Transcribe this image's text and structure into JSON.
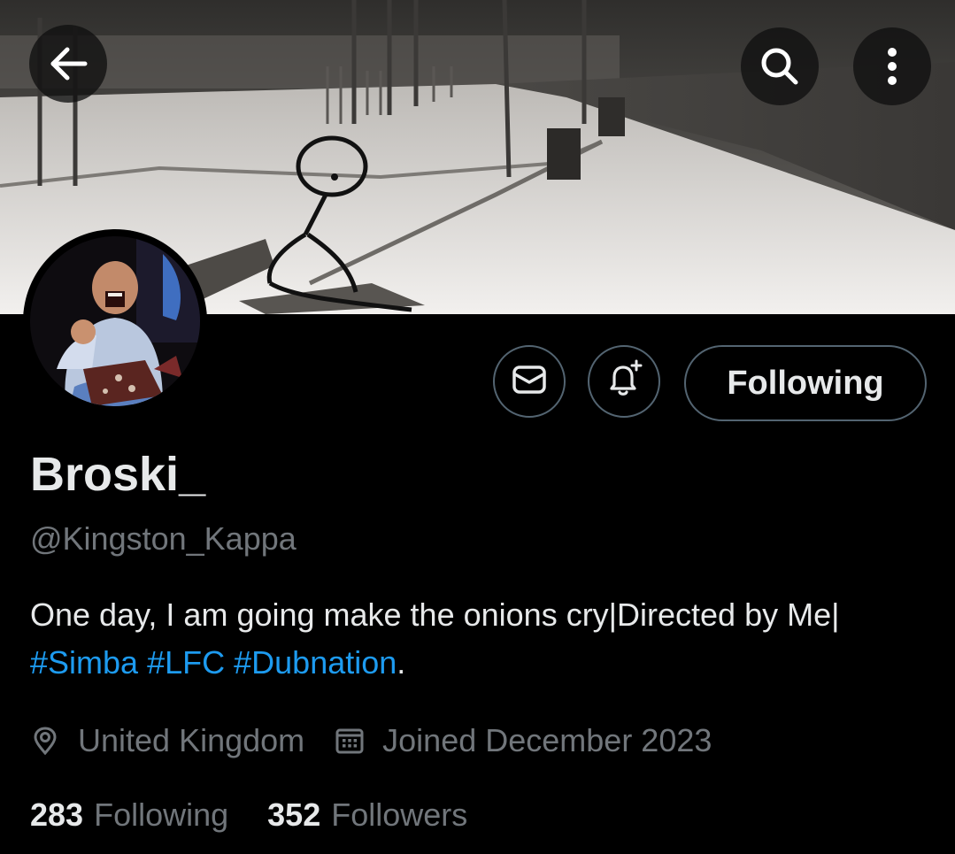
{
  "header": {
    "back_icon": "arrow-left-icon",
    "search_icon": "search-icon",
    "more_icon": "more-vertical-icon"
  },
  "actions": {
    "message_icon": "envelope-icon",
    "notify_icon": "bell-plus-icon",
    "follow_label": "Following"
  },
  "profile": {
    "display_name": "Broski_",
    "handle": "@Kingston_Kappa",
    "bio_text": "One day, I am going make the onions cry|Directed by Me|",
    "bio_hashtags": [
      "#Simba",
      "#LFC",
      "#Dubnation"
    ],
    "bio_suffix": ".",
    "location": "United Kingdom",
    "joined": "Joined December 2023"
  },
  "stats": {
    "following_count": "283",
    "following_label": "Following",
    "followers_count": "352",
    "followers_label": "Followers"
  },
  "colors": {
    "background": "#000000",
    "text_primary": "#e7e9ea",
    "text_secondary": "#71767b",
    "border": "#536471",
    "link": "#1d9bf0"
  }
}
